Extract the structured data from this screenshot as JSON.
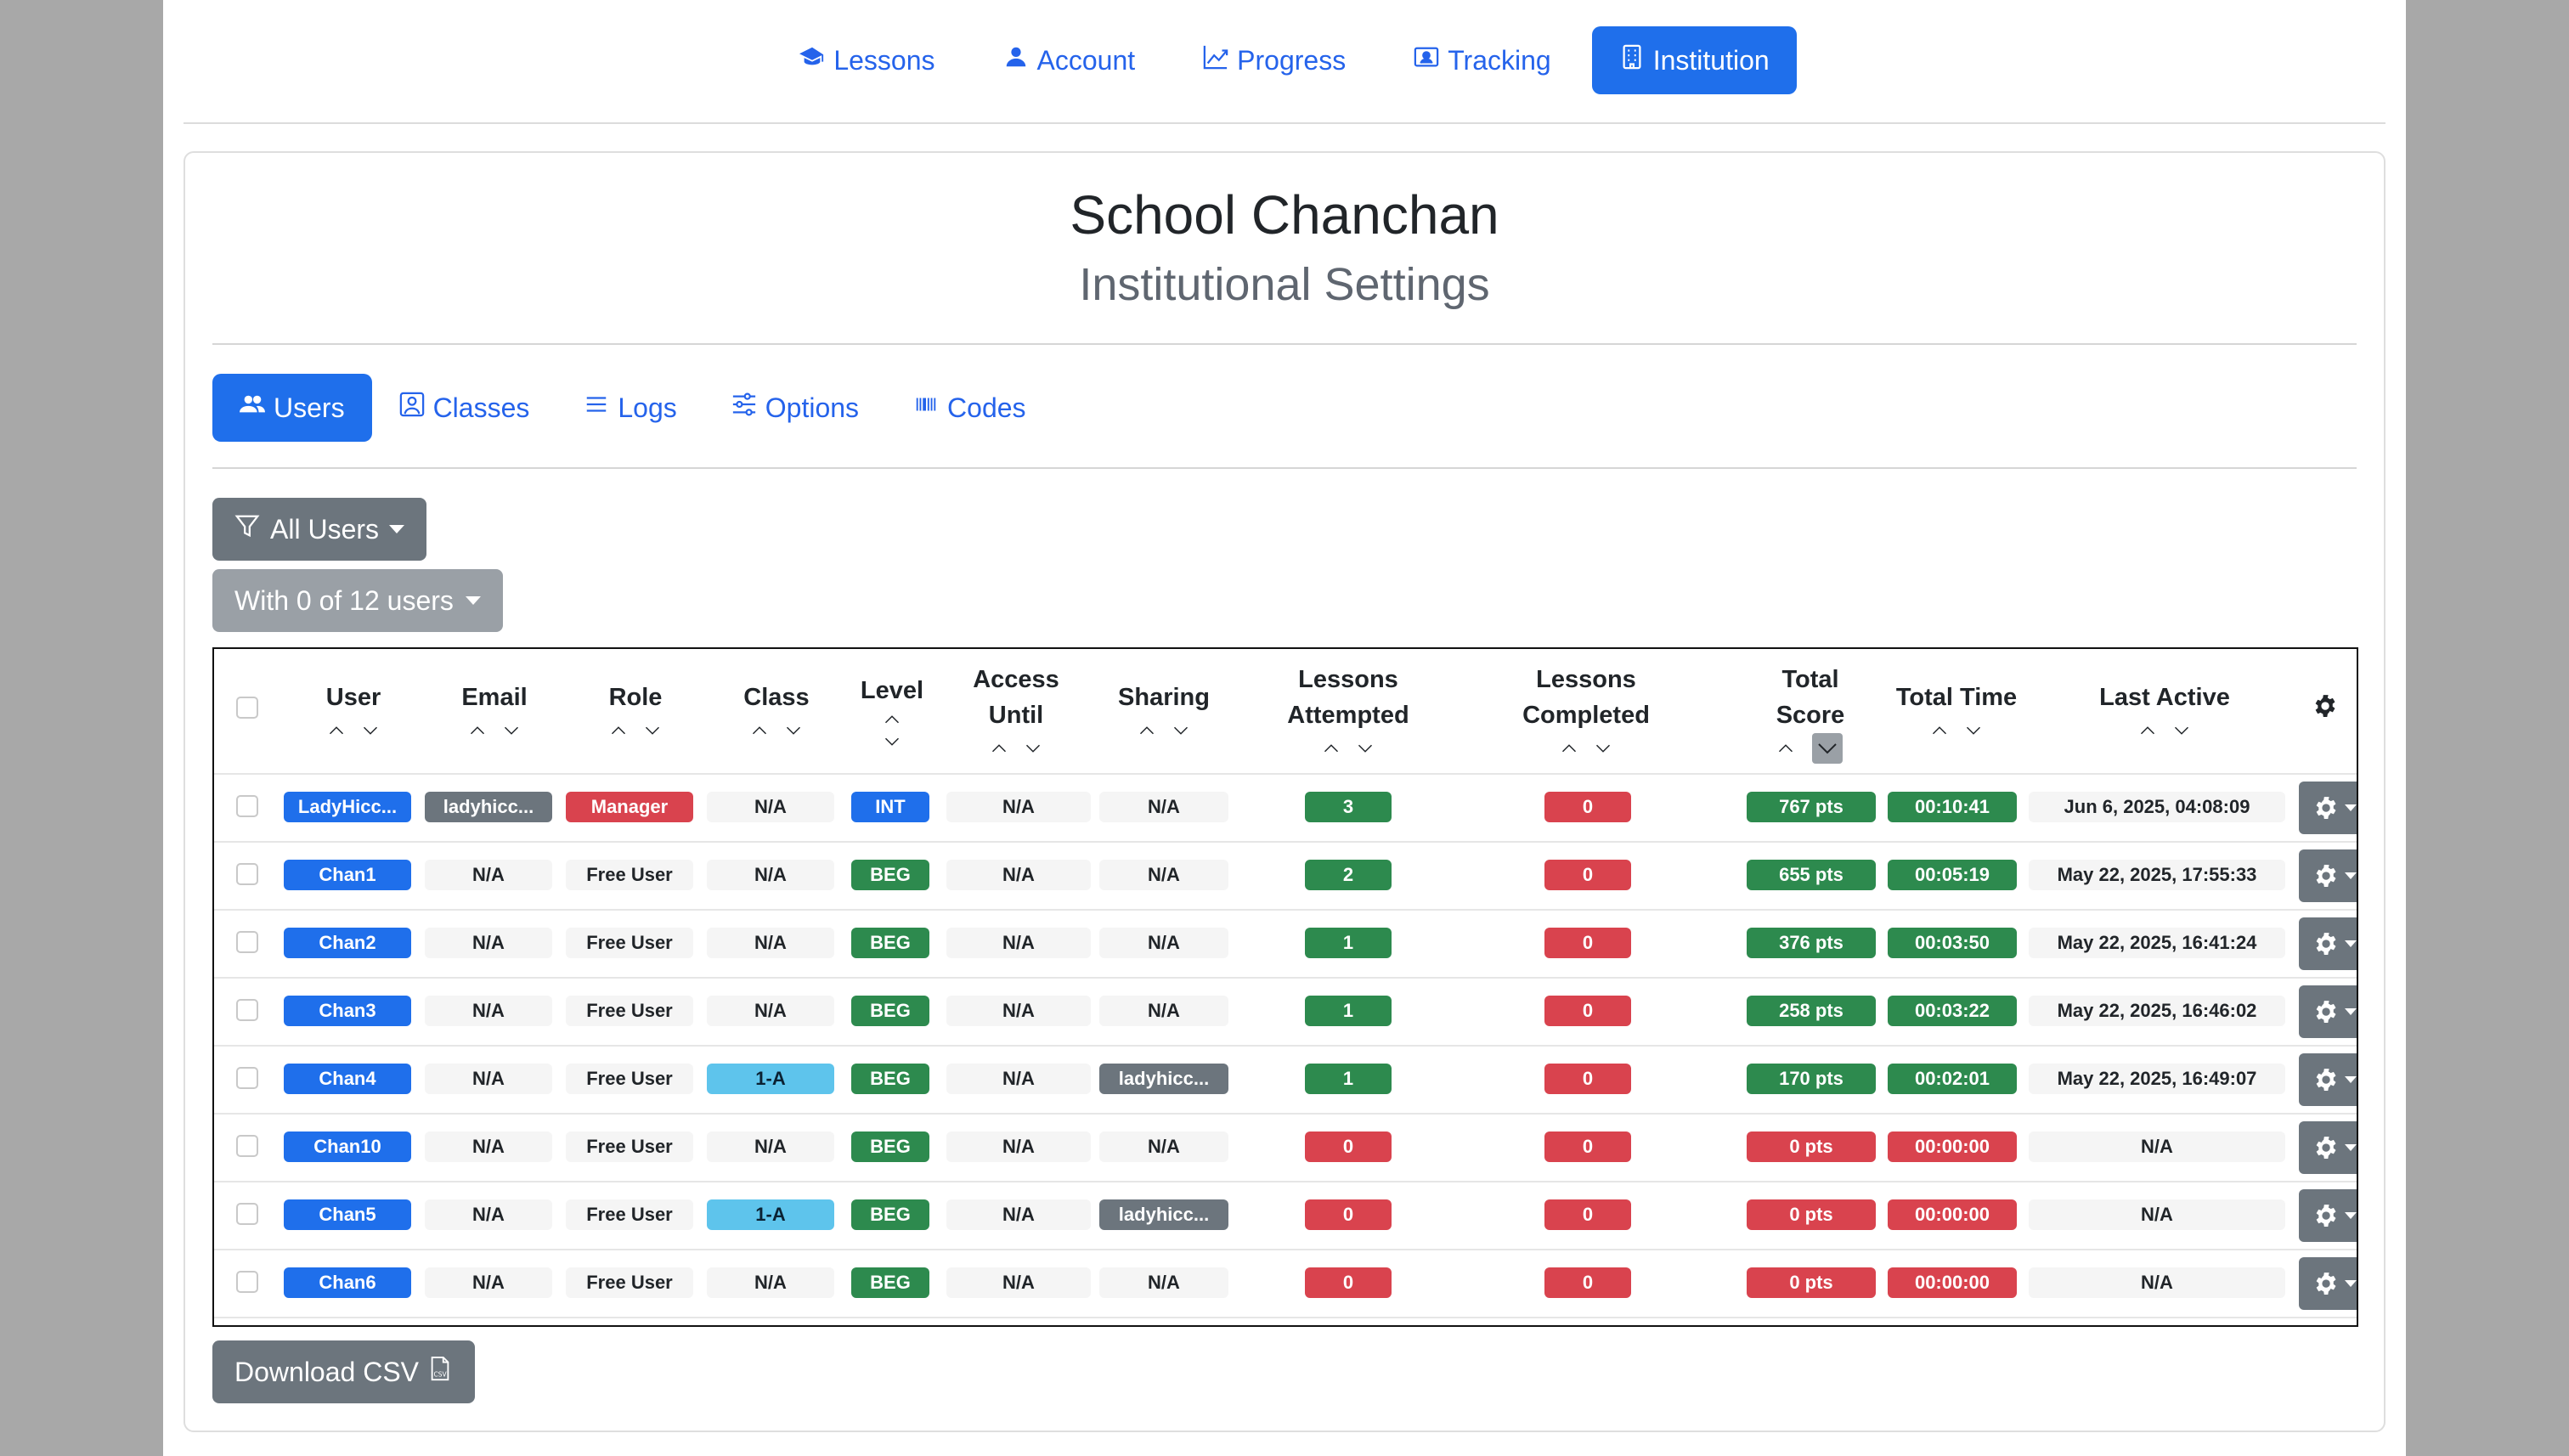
{
  "topnav": [
    {
      "label": "Lessons",
      "icon": "graduation-cap-icon",
      "active": false
    },
    {
      "label": "Account",
      "icon": "person-icon",
      "active": false
    },
    {
      "label": "Progress",
      "icon": "chart-line-icon",
      "active": false
    },
    {
      "label": "Tracking",
      "icon": "person-badge-icon",
      "active": false
    },
    {
      "label": "Institution",
      "icon": "building-icon",
      "active": true
    }
  ],
  "card": {
    "title": "School Chanchan",
    "subtitle": "Institutional Settings"
  },
  "subnav": [
    {
      "label": "Users",
      "icon": "people-icon",
      "active": true
    },
    {
      "label": "Classes",
      "icon": "person-square-icon",
      "active": false
    },
    {
      "label": "Logs",
      "icon": "list-icon",
      "active": false
    },
    {
      "label": "Options",
      "icon": "sliders-icon",
      "active": false
    },
    {
      "label": "Codes",
      "icon": "barcode-icon",
      "active": false
    }
  ],
  "filters": {
    "users_label": "All Users",
    "with_label": "With 0 of 12 users"
  },
  "table": {
    "headers": {
      "user": "User",
      "email": "Email",
      "role": "Role",
      "class": "Class",
      "level": "Level",
      "access1": "Access",
      "access2": "Until",
      "sharing": "Sharing",
      "la1": "Lessons",
      "la2": "Attempted",
      "lc1": "Lessons",
      "lc2": "Completed",
      "ts1": "Total",
      "ts2": "Score",
      "time": "Total Time",
      "last": "Last Active"
    },
    "rows": [
      {
        "user": "LadyHicc...",
        "email": "ladyhicc...",
        "role": "Manager",
        "class": "N/A",
        "level": "INT",
        "access": "N/A",
        "sharing": "N/A",
        "attempted": "3",
        "completed": "0",
        "score": "767 pts",
        "time": "00:10:41",
        "last": "Jun 6, 2025, 04:08:09"
      },
      {
        "user": "Chan1",
        "email": "N/A",
        "role": "Free User",
        "class": "N/A",
        "level": "BEG",
        "access": "N/A",
        "sharing": "N/A",
        "attempted": "2",
        "completed": "0",
        "score": "655 pts",
        "time": "00:05:19",
        "last": "May 22, 2025, 17:55:33"
      },
      {
        "user": "Chan2",
        "email": "N/A",
        "role": "Free User",
        "class": "N/A",
        "level": "BEG",
        "access": "N/A",
        "sharing": "N/A",
        "attempted": "1",
        "completed": "0",
        "score": "376 pts",
        "time": "00:03:50",
        "last": "May 22, 2025, 16:41:24"
      },
      {
        "user": "Chan3",
        "email": "N/A",
        "role": "Free User",
        "class": "N/A",
        "level": "BEG",
        "access": "N/A",
        "sharing": "N/A",
        "attempted": "1",
        "completed": "0",
        "score": "258 pts",
        "time": "00:03:22",
        "last": "May 22, 2025, 16:46:02"
      },
      {
        "user": "Chan4",
        "email": "N/A",
        "role": "Free User",
        "class": "1-A",
        "level": "BEG",
        "access": "N/A",
        "sharing": "ladyhicc...",
        "attempted": "1",
        "completed": "0",
        "score": "170 pts",
        "time": "00:02:01",
        "last": "May 22, 2025, 16:49:07"
      },
      {
        "user": "Chan10",
        "email": "N/A",
        "role": "Free User",
        "class": "N/A",
        "level": "BEG",
        "access": "N/A",
        "sharing": "N/A",
        "attempted": "0",
        "completed": "0",
        "score": "0 pts",
        "time": "00:00:00",
        "last": "N/A"
      },
      {
        "user": "Chan5",
        "email": "N/A",
        "role": "Free User",
        "class": "1-A",
        "level": "BEG",
        "access": "N/A",
        "sharing": "ladyhicc...",
        "attempted": "0",
        "completed": "0",
        "score": "0 pts",
        "time": "00:00:00",
        "last": "N/A"
      },
      {
        "user": "Chan6",
        "email": "N/A",
        "role": "Free User",
        "class": "N/A",
        "level": "BEG",
        "access": "N/A",
        "sharing": "N/A",
        "attempted": "0",
        "completed": "0",
        "score": "0 pts",
        "time": "00:00:00",
        "last": "N/A"
      }
    ]
  },
  "download_label": "Download CSV",
  "colors": {
    "primary": "#1f6feb",
    "secondary": "#6c757d",
    "danger": "#d9434e",
    "success": "#2d8a4e",
    "info": "#5ec4ec"
  }
}
